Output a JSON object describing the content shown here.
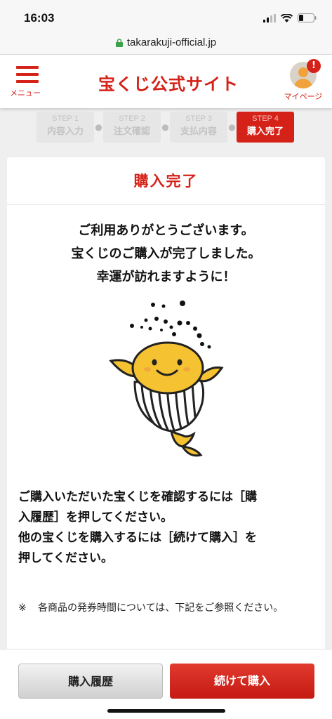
{
  "status_bar": {
    "time": "16:03"
  },
  "browser": {
    "url": "takarakuji-official.jp"
  },
  "header": {
    "menu_label": "メニュー",
    "site_title": "宝くじ公式サイト",
    "mypage_label": "マイページ",
    "notification_badge": "!"
  },
  "steps": [
    {
      "num": "STEP 1",
      "label": "内容入力",
      "active": false
    },
    {
      "num": "STEP 2",
      "label": "注文確認",
      "active": false
    },
    {
      "num": "STEP 3",
      "label": "支払内容",
      "active": false
    },
    {
      "num": "STEP 4",
      "label": "購入完了",
      "active": true
    }
  ],
  "main": {
    "title": "購入完了",
    "message_lines": [
      "ご利用ありがとうございます。",
      "宝くじのご購入が完了しました。",
      "幸運が訪れますように！"
    ],
    "note_lines": [
      "ご購入いただいた宝くじを確認するには［購",
      "入履歴］を押してください。",
      "他の宝くじを購入するには［続けて購入］を",
      "押してください。"
    ],
    "footnote_mark": "※",
    "footnote_text": "各商品の発券時間については、下記をご参照ください。"
  },
  "buttons": {
    "history": "購入履歴",
    "continue": "続けて購入"
  },
  "colors": {
    "brand_red": "#d52218",
    "mascot_yellow": "#f5c232"
  }
}
